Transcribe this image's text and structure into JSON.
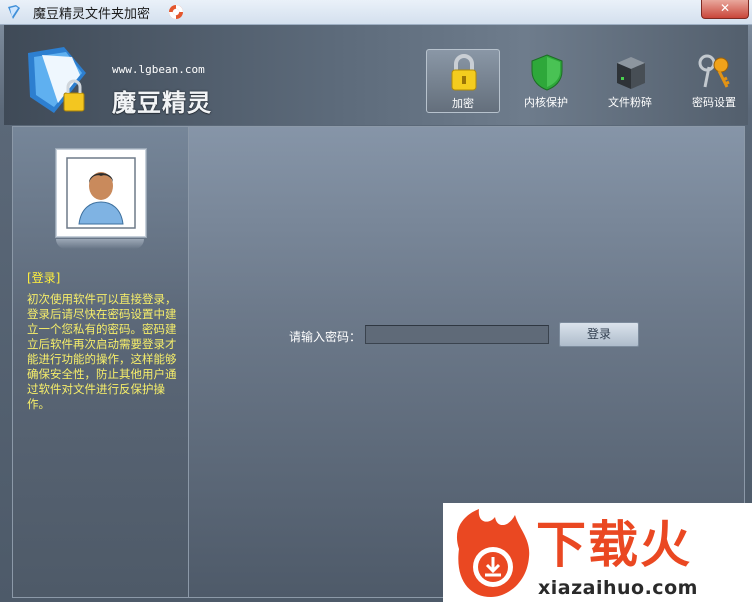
{
  "window": {
    "title": "魔豆精灵文件夹加密",
    "close_label": "✕"
  },
  "header": {
    "site_url": "www.lgbean.com",
    "brand": "魔豆精灵"
  },
  "toolbar": {
    "items": [
      {
        "label": "加密",
        "icon": "lock-icon",
        "active": true
      },
      {
        "label": "内核保护",
        "icon": "shield-icon",
        "active": false
      },
      {
        "label": "文件粉碎",
        "icon": "shredder-icon",
        "active": false
      },
      {
        "label": "密码设置",
        "icon": "key-icon",
        "active": false
      }
    ]
  },
  "sidebar": {
    "heading": "[登录]",
    "description": "初次使用软件可以直接登录，登录后请尽快在密码设置中建立一个您私有的密码。密码建立后软件再次启动需要登录才能进行功能的操作，这样能够确保安全性，防止其他用户通过软件对文件进行反保护操作。"
  },
  "login": {
    "password_label": "请输入密码：",
    "password_value": "",
    "button_label": "登录"
  },
  "watermark": {
    "text_cn": "下载火",
    "url": "xiazaihuo.com"
  },
  "colors": {
    "accent_yellow": "#f6ee6a",
    "panel_blue": "#5a6676",
    "watermark_orange": "#ea4822"
  }
}
